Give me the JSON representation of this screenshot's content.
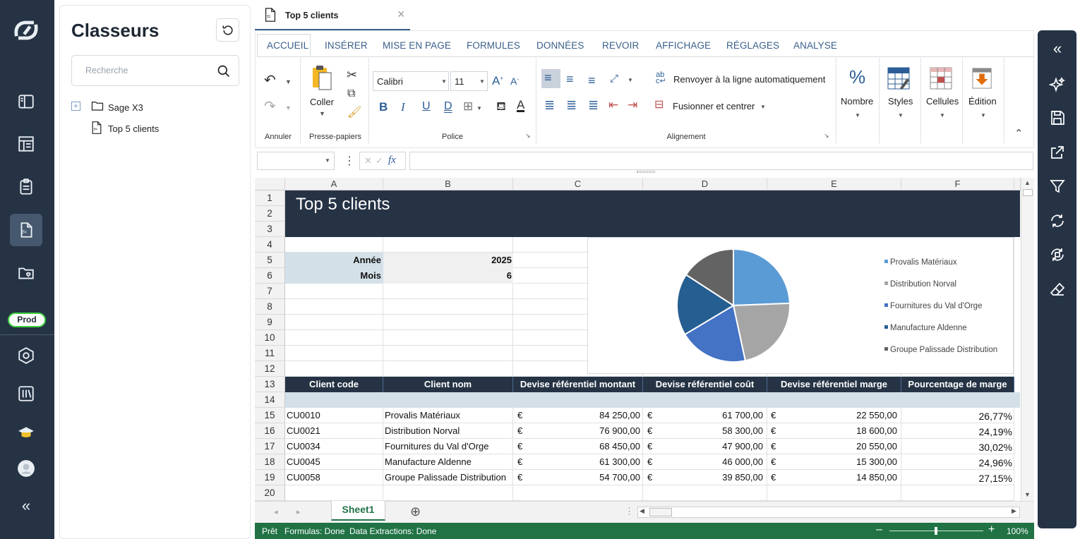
{
  "app": {
    "env_badge": "Prod"
  },
  "workbooks": {
    "title": "Classeurs",
    "search_placeholder": "Recherche",
    "tree": [
      {
        "label": "Sage X3",
        "type": "folder"
      },
      {
        "label": "Top 5 clients",
        "type": "sheet"
      }
    ]
  },
  "doc_tab": {
    "label": "Top 5 clients",
    "close": "×"
  },
  "ribbon": {
    "tabs": [
      "ACCUEIL",
      "INSÉRER",
      "MISE EN PAGE",
      "FORMULES",
      "DONNÉES",
      "REVOIR",
      "AFFICHAGE",
      "RÉGLAGES",
      "ANALYSE"
    ],
    "active_tab": "ACCUEIL",
    "groups": {
      "undo": "Annuler",
      "clipboard": "Presse-papiers",
      "font": "Police",
      "alignment": "Alignement"
    },
    "paste_label": "Coller",
    "font_name": "Calibri",
    "font_size": "11",
    "wrap_text": "Renvoyer à la ligne automatiquement",
    "merge_center": "Fusionner et centrer",
    "number": "Nombre",
    "styles": "Styles",
    "cells": "Cellules",
    "editing": "Édition"
  },
  "formula_bar": {
    "fx": "fx"
  },
  "sheet": {
    "columns": [
      "A",
      "B",
      "C",
      "D",
      "E",
      "F"
    ],
    "rows": [
      "1",
      "2",
      "3",
      "4",
      "5",
      "6",
      "7",
      "8",
      "9",
      "10",
      "11",
      "12",
      "13",
      "14",
      "15",
      "16",
      "17",
      "18",
      "19",
      "20"
    ],
    "title": "Top 5 clients",
    "year_label": "Année",
    "year_value": "2025",
    "month_label": "Mois",
    "month_value": "6",
    "table_headers": [
      "Client code",
      "Client nom",
      "Devise référentiel montant",
      "Devise référentiel coût",
      "Devise référentiel marge",
      "Pourcentage de marge"
    ],
    "table_rows": [
      {
        "code": "CU0010",
        "name": "Provalis Matériaux",
        "cur1": "€",
        "amount": "84 250,00",
        "cur2": "€",
        "cost": "61 700,00",
        "cur3": "€",
        "margin": "22 550,00",
        "pct": "26,77%"
      },
      {
        "code": "CU0021",
        "name": "Distribution Norval",
        "cur1": "€",
        "amount": "76 900,00",
        "cur2": "€",
        "cost": "58 300,00",
        "cur3": "€",
        "margin": "18 600,00",
        "pct": "24,19%"
      },
      {
        "code": "CU0034",
        "name": "Fournitures du Val d'Orge",
        "cur1": "€",
        "amount": "68 450,00",
        "cur2": "€",
        "cost": "47 900,00",
        "cur3": "€",
        "margin": "20 550,00",
        "pct": "30,02%"
      },
      {
        "code": "CU0045",
        "name": "Manufacture Aldenne",
        "cur1": "€",
        "amount": "61 300,00",
        "cur2": "€",
        "cost": "46 000,00",
        "cur3": "€",
        "margin": "15 300,00",
        "pct": "24,96%"
      },
      {
        "code": "CU0058",
        "name": "Groupe Palissade Distribution",
        "cur1": "€",
        "amount": "54 700,00",
        "cur2": "€",
        "cost": "39 850,00",
        "cur3": "€",
        "margin": "14 850,00",
        "pct": "27,15%"
      }
    ],
    "sheet_tab": "Sheet1"
  },
  "chart_data": {
    "type": "pie",
    "categories": [
      "Provalis Matériaux",
      "Distribution Norval",
      "Fournitures du Val d'Orge",
      "Manufacture Aldenne",
      "Groupe Palissade Distribution"
    ],
    "values": [
      84250,
      76900,
      68450,
      61300,
      54700
    ],
    "colors": [
      "#5b9bd5",
      "#a5a5a5",
      "#4472c4",
      "#255e91",
      "#636363"
    ],
    "legend": "right"
  },
  "status": {
    "ready": "Prêt",
    "formulas": "Formulas: Done",
    "extractions": "Data Extractions: Done",
    "zoom": "100%"
  }
}
